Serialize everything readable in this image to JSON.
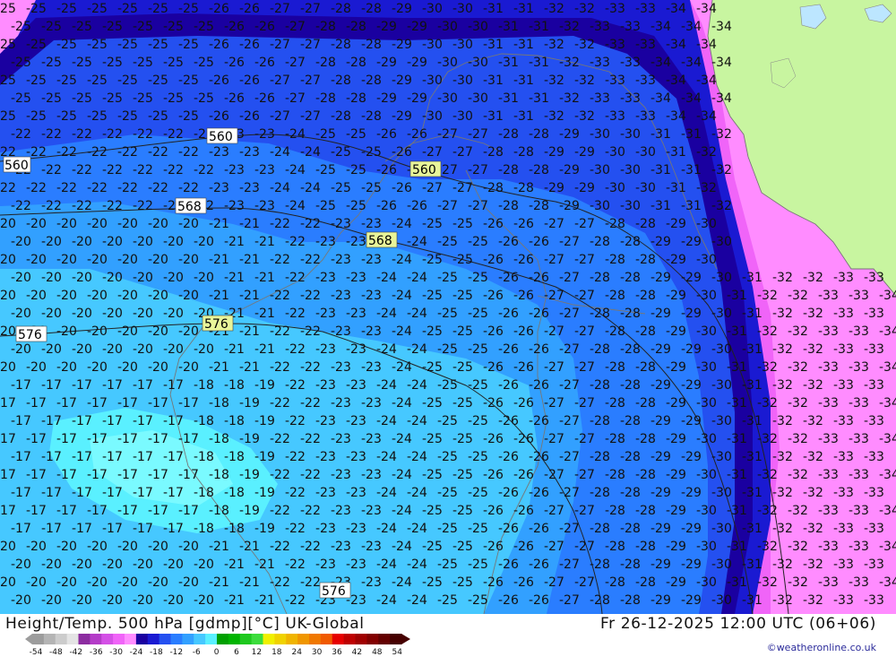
{
  "map": {
    "sea_color": "#f5f5f5",
    "land_color": "#c8f5a0",
    "isotherms": [
      "-17",
      "-18",
      "-19",
      "-20",
      "-21",
      "-22",
      "-23",
      "-24",
      "-25",
      "-26",
      "-27",
      "-28",
      "-29",
      "-30",
      "-31",
      "-32",
      "-33",
      "-34"
    ],
    "height_labels": [
      "560",
      "560",
      "560",
      "568",
      "568",
      "576",
      "576",
      "576"
    ],
    "legend_colors": [
      "#9c9c9c",
      "#b4b4b4",
      "#cccccc",
      "#e4e4e4",
      "#8c2ca0",
      "#b43cc8",
      "#d450e6",
      "#f064f8",
      "#ff8cff",
      "#1a00a0",
      "#1a1ad2",
      "#2450f0",
      "#2a7dff",
      "#32a0ff",
      "#46c8ff",
      "#5af0ff",
      "#00a000",
      "#00b400",
      "#1ec81e",
      "#3cdc3c",
      "#f0f000",
      "#f0d200",
      "#f0b400",
      "#f09600",
      "#f07800",
      "#f05a00",
      "#e60000",
      "#be0000",
      "#a00000",
      "#820000",
      "#640000",
      "#460000"
    ]
  },
  "footer": {
    "title_left": "Height/Temp. 500 hPa [gdmp][°C] UK-Global",
    "title_right": "Fr 26-12-2025 12:00 UTC (06+06)",
    "credit": "©weatheronline.co.uk",
    "scale_ticks": [
      "-54",
      "-48",
      "-42",
      "-36",
      "-30",
      "-24",
      "-18",
      "-12",
      "-6",
      "0",
      "6",
      "12",
      "18",
      "24",
      "30",
      "36",
      "42",
      "48",
      "54"
    ]
  }
}
